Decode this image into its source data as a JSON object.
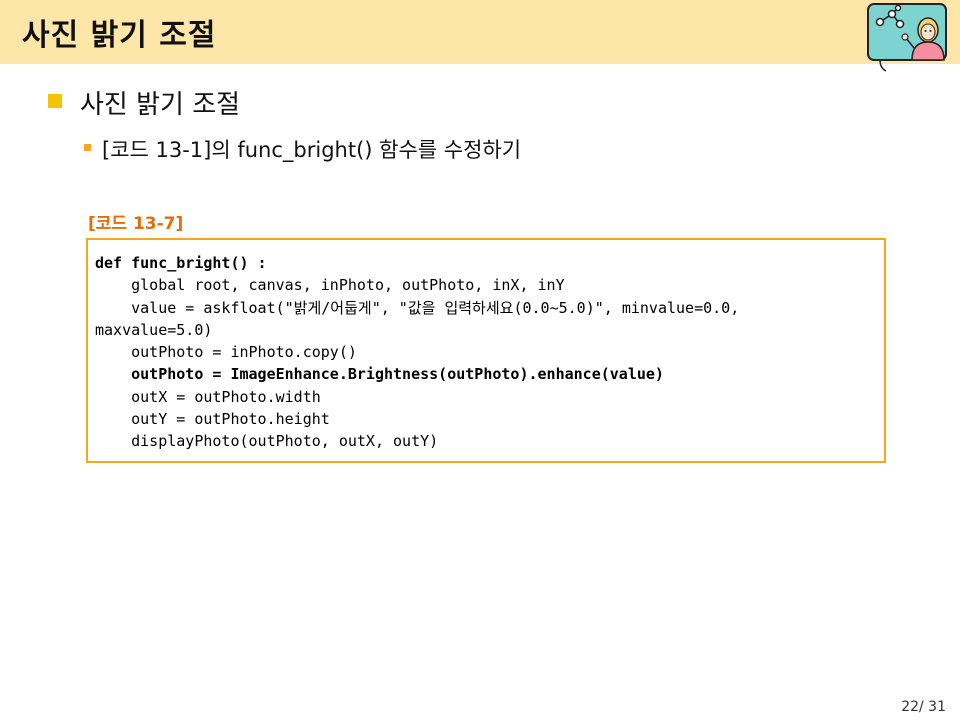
{
  "slide": {
    "title": "사진 밝기 조절",
    "heading": "사진 밝기 조절",
    "subheading": "[코드 13-1]의 func_bright() 함수를 수정하기",
    "page": "22/ 31"
  },
  "code": {
    "label": "[코드 13-7]",
    "lines": [
      {
        "text": "def func_bright() :",
        "bold": true
      },
      {
        "text": "    global root, canvas, inPhoto, outPhoto, inX, inY",
        "bold": false
      },
      {
        "text": "    value = askfloat(\"밝게/어둡게\", \"값을 입력하세요(0.0~5.0)\", minvalue=0.0,",
        "bold": false
      },
      {
        "text": "maxvalue=5.0)",
        "bold": false
      },
      {
        "text": "    outPhoto = inPhoto.copy()",
        "bold": false
      },
      {
        "text": "    outPhoto = ImageEnhance.Brightness(outPhoto).enhance(value)",
        "bold": true
      },
      {
        "text": "    outX = outPhoto.width",
        "bold": false
      },
      {
        "text": "    outY = outPhoto.height",
        "bold": false
      },
      {
        "text": "    displayPhoto(outPhoto, outX, outY)",
        "bold": false
      }
    ]
  },
  "colors": {
    "title_bar": "#fde6a8",
    "bullet_main": "#f5c400",
    "bullet_sub": "#f5a623",
    "code_label": "#e46c0a",
    "code_border": "#f5a623"
  },
  "icons": {
    "logo": "presenter-illustration-icon"
  }
}
